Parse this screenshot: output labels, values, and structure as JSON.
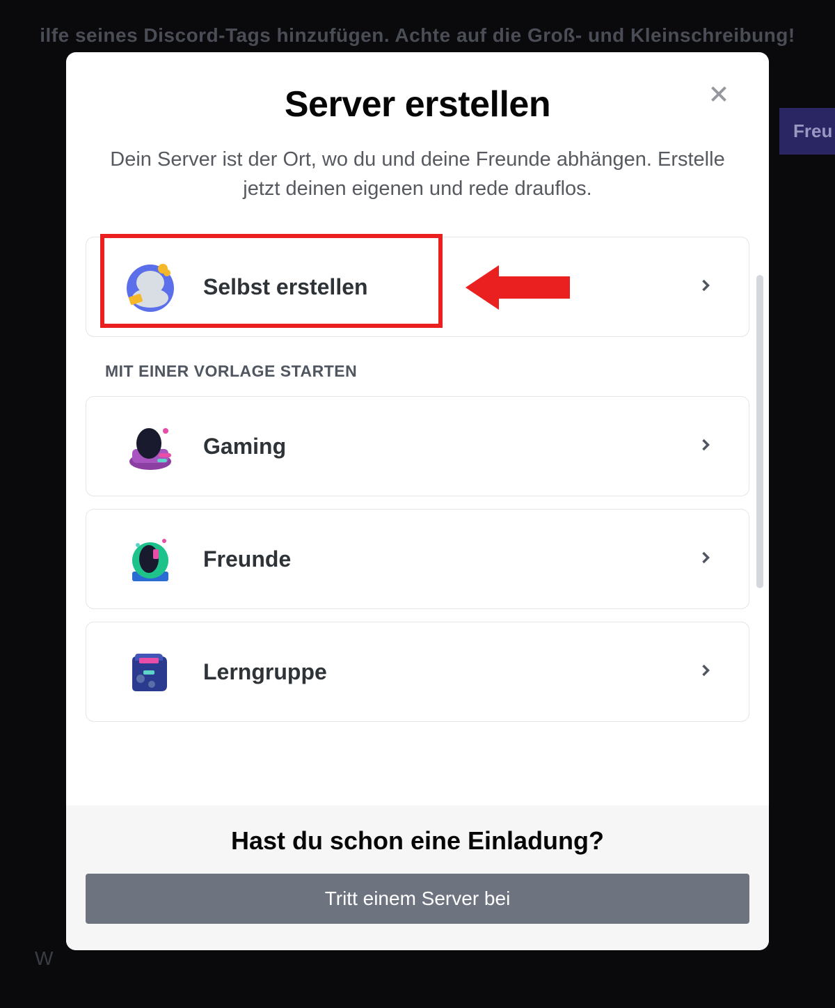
{
  "background": {
    "top_text": "ilfe seines Discord-Tags hinzufügen. Achte auf die Groß- und Kleinschreibung!",
    "right_button": "Freu",
    "bottom_text": "W"
  },
  "modal": {
    "title": "Server erstellen",
    "subtitle": "Dein Server ist der Ort, wo du und deine Freunde abhängen. Erstelle jetzt deinen eigenen und rede drauflos.",
    "options": {
      "create_own": "Selbst erstellen"
    },
    "template_header": "MIT EINER VORLAGE STARTEN",
    "templates": [
      {
        "label": "Gaming",
        "id": "gaming"
      },
      {
        "label": "Freunde",
        "id": "friends"
      },
      {
        "label": "Lerngruppe",
        "id": "study"
      }
    ],
    "footer": {
      "title": "Hast du schon eine Einladung?",
      "join_button": "Tritt einem Server bei"
    }
  }
}
